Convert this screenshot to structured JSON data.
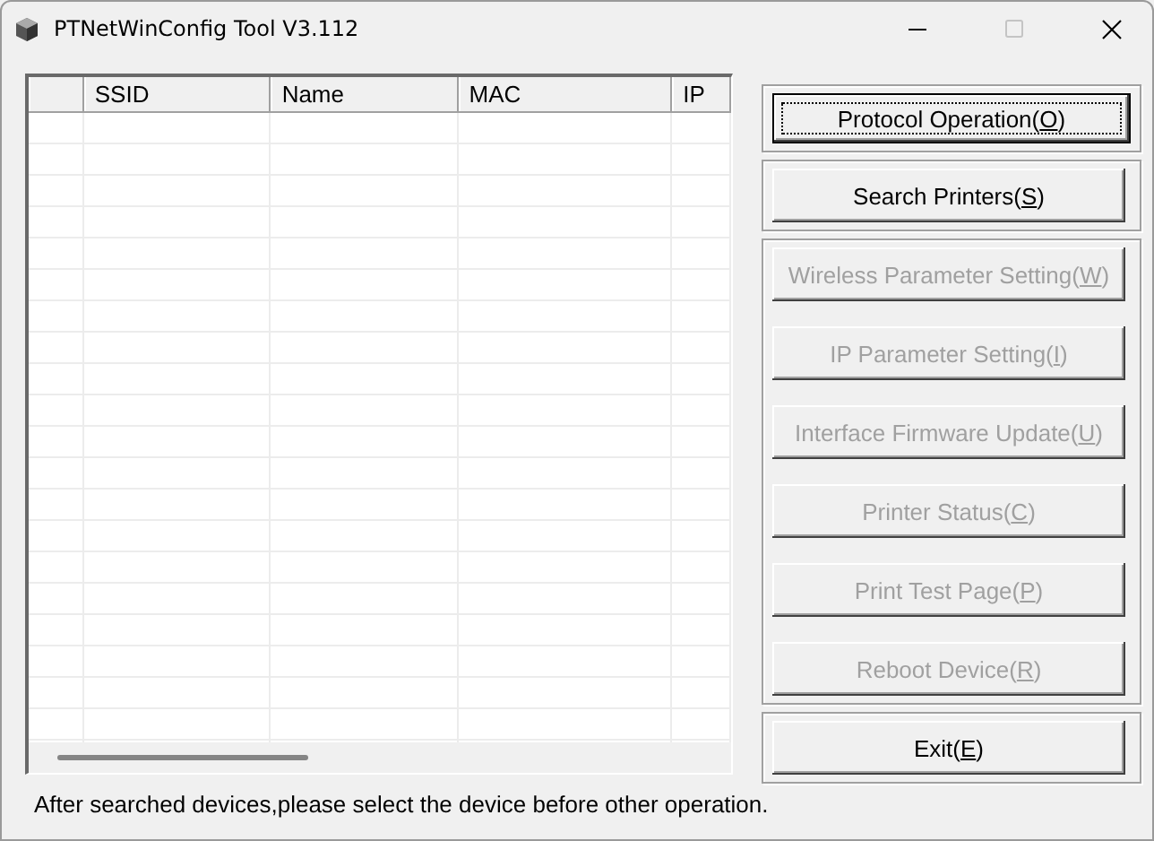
{
  "window": {
    "title": "PTNetWinConfig Tool V3.112"
  },
  "table": {
    "columns": [
      "SSID",
      "Name",
      "MAC",
      "IP"
    ]
  },
  "button_groups": [
    {
      "buttons": [
        {
          "label": "Protocol Operation(",
          "key": "O",
          "end": ")",
          "disabled": false,
          "default": true
        }
      ]
    },
    {
      "buttons": [
        {
          "label": "Search Printers(",
          "key": "S",
          "end": ")",
          "disabled": false,
          "default": false
        }
      ]
    },
    {
      "buttons": [
        {
          "label": "Wireless Parameter Setting(",
          "key": "W",
          "end": ")",
          "disabled": true,
          "default": false
        },
        {
          "label": "IP Parameter Setting(",
          "key": "I",
          "end": ")",
          "disabled": true,
          "default": false
        },
        {
          "label": "Interface Firmware Update(",
          "key": "U",
          "end": ")",
          "disabled": true,
          "default": false
        },
        {
          "label": "Printer Status(",
          "key": "C",
          "end": ")",
          "disabled": true,
          "default": false
        },
        {
          "label": "Print Test Page(",
          "key": "P",
          "end": ")",
          "disabled": true,
          "default": false
        },
        {
          "label": "Reboot Device(",
          "key": "R",
          "end": ")",
          "disabled": true,
          "default": false
        }
      ]
    },
    {
      "buttons": [
        {
          "label": "Exit(",
          "key": "E",
          "end": ")",
          "disabled": false,
          "default": false
        }
      ]
    }
  ],
  "status_bar": "After searched devices,please select the device before other operation."
}
